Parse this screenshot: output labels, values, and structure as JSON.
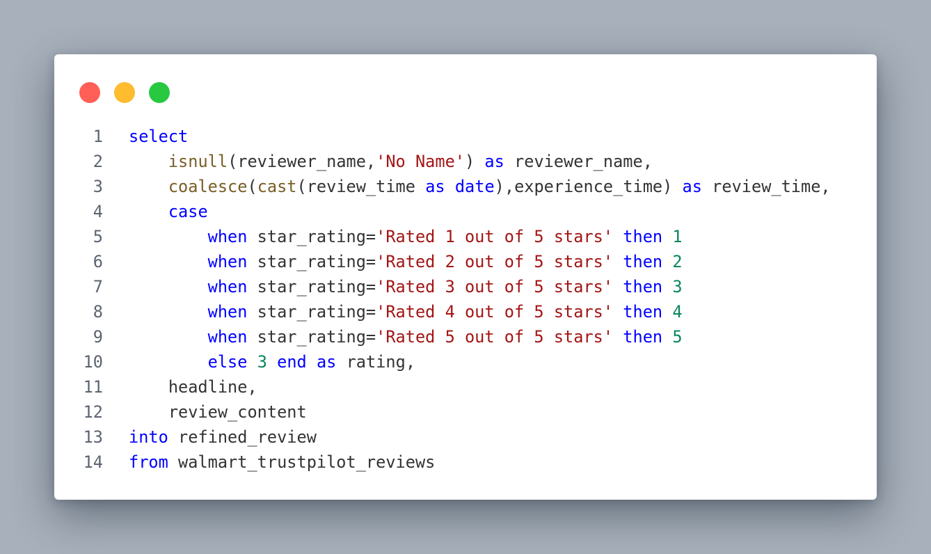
{
  "window": {
    "controls": [
      {
        "name": "close",
        "color": "#ff5f57"
      },
      {
        "name": "minimize",
        "color": "#febc2e"
      },
      {
        "name": "maximize",
        "color": "#28c840"
      }
    ]
  },
  "colors": {
    "keyword": "#0000ff",
    "function": "#795e26",
    "string": "#a31515",
    "number": "#098658",
    "plain": "#333333",
    "line_number": "#5c6370"
  },
  "code": {
    "lines": [
      {
        "num": "1",
        "tokens": [
          [
            "kw",
            "select"
          ]
        ]
      },
      {
        "num": "2",
        "tokens": [
          [
            "plain",
            "    "
          ],
          [
            "fn",
            "isnull"
          ],
          [
            "plain",
            "(reviewer_name,"
          ],
          [
            "str",
            "'No Name'"
          ],
          [
            "plain",
            ") "
          ],
          [
            "kw",
            "as"
          ],
          [
            "plain",
            " reviewer_name,"
          ]
        ]
      },
      {
        "num": "3",
        "tokens": [
          [
            "plain",
            "    "
          ],
          [
            "fn",
            "coalesce"
          ],
          [
            "plain",
            "("
          ],
          [
            "fn",
            "cast"
          ],
          [
            "plain",
            "(review_time "
          ],
          [
            "kw",
            "as"
          ],
          [
            "plain",
            " "
          ],
          [
            "kw",
            "date"
          ],
          [
            "plain",
            "),experience_time) "
          ],
          [
            "kw",
            "as"
          ],
          [
            "plain",
            " review_time,"
          ]
        ]
      },
      {
        "num": "4",
        "tokens": [
          [
            "plain",
            "    "
          ],
          [
            "kw",
            "case"
          ]
        ]
      },
      {
        "num": "5",
        "tokens": [
          [
            "plain",
            "        "
          ],
          [
            "kw",
            "when"
          ],
          [
            "plain",
            " star_rating="
          ],
          [
            "str",
            "'Rated 1 out of 5 stars'"
          ],
          [
            "plain",
            " "
          ],
          [
            "kw",
            "then"
          ],
          [
            "plain",
            " "
          ],
          [
            "num",
            "1"
          ]
        ]
      },
      {
        "num": "6",
        "tokens": [
          [
            "plain",
            "        "
          ],
          [
            "kw",
            "when"
          ],
          [
            "plain",
            " star_rating="
          ],
          [
            "str",
            "'Rated 2 out of 5 stars'"
          ],
          [
            "plain",
            " "
          ],
          [
            "kw",
            "then"
          ],
          [
            "plain",
            " "
          ],
          [
            "num",
            "2"
          ]
        ]
      },
      {
        "num": "7",
        "tokens": [
          [
            "plain",
            "        "
          ],
          [
            "kw",
            "when"
          ],
          [
            "plain",
            " star_rating="
          ],
          [
            "str",
            "'Rated 3 out of 5 stars'"
          ],
          [
            "plain",
            " "
          ],
          [
            "kw",
            "then"
          ],
          [
            "plain",
            " "
          ],
          [
            "num",
            "3"
          ]
        ]
      },
      {
        "num": "8",
        "tokens": [
          [
            "plain",
            "        "
          ],
          [
            "kw",
            "when"
          ],
          [
            "plain",
            " star_rating="
          ],
          [
            "str",
            "'Rated 4 out of 5 stars'"
          ],
          [
            "plain",
            " "
          ],
          [
            "kw",
            "then"
          ],
          [
            "plain",
            " "
          ],
          [
            "num",
            "4"
          ]
        ]
      },
      {
        "num": "9",
        "tokens": [
          [
            "plain",
            "        "
          ],
          [
            "kw",
            "when"
          ],
          [
            "plain",
            " star_rating="
          ],
          [
            "str",
            "'Rated 5 out of 5 stars'"
          ],
          [
            "plain",
            " "
          ],
          [
            "kw",
            "then"
          ],
          [
            "plain",
            " "
          ],
          [
            "num",
            "5"
          ]
        ]
      },
      {
        "num": "10",
        "tokens": [
          [
            "plain",
            "        "
          ],
          [
            "kw",
            "else"
          ],
          [
            "plain",
            " "
          ],
          [
            "num",
            "3"
          ],
          [
            "plain",
            " "
          ],
          [
            "kw",
            "end"
          ],
          [
            "plain",
            " "
          ],
          [
            "kw",
            "as"
          ],
          [
            "plain",
            " rating,"
          ]
        ]
      },
      {
        "num": "11",
        "tokens": [
          [
            "plain",
            "    headline,"
          ]
        ]
      },
      {
        "num": "12",
        "tokens": [
          [
            "plain",
            "    review_content"
          ]
        ]
      },
      {
        "num": "13",
        "tokens": [
          [
            "kw",
            "into"
          ],
          [
            "plain",
            " refined_review"
          ]
        ]
      },
      {
        "num": "14",
        "tokens": [
          [
            "kw",
            "from"
          ],
          [
            "plain",
            " walmart_trustpilot_reviews"
          ]
        ]
      }
    ]
  }
}
